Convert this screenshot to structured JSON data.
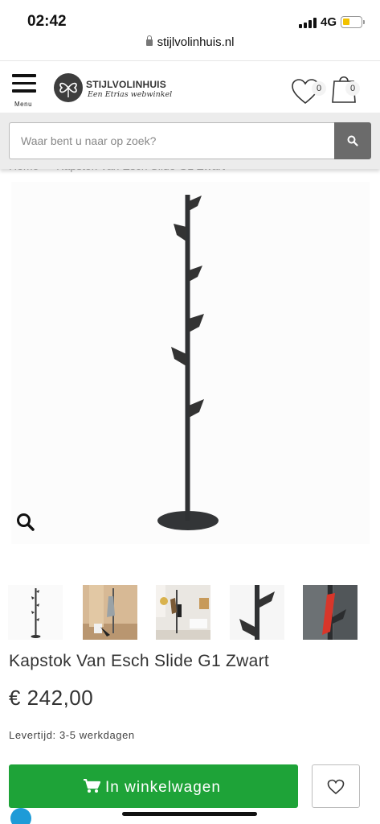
{
  "status": {
    "time": "02:42",
    "network": "4G"
  },
  "browser": {
    "url": "stijlvolinhuis.nl"
  },
  "header": {
    "menu_label": "Menu",
    "logo_name": "STIJLVOLINHUIS",
    "logo_tagline": "Een Etrias webwinkel",
    "wishlist_count": "0",
    "cart_count": "0"
  },
  "search": {
    "placeholder": "Waar bent u naar op zoek?"
  },
  "breadcrumb": "Home  —  Kapstok Van Esch Slide G1 Zwart",
  "product": {
    "title": "Kapstok Van Esch Slide G1 Zwart",
    "price": "€ 242,00",
    "delivery": "Levertijd: 3-5 werkdagen",
    "add_to_cart": "In winkelwagen"
  },
  "colors": {
    "cta_green": "#1ea338",
    "search_button": "#6b6b6b",
    "product_black": "#2f3133"
  },
  "icons": [
    "lock-icon",
    "menu-icon",
    "heart-icon",
    "shopping-bag-icon",
    "search-icon",
    "zoom-icon",
    "cart-icon"
  ]
}
